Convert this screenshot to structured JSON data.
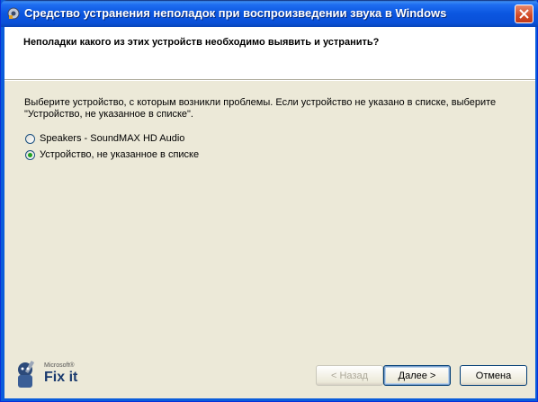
{
  "window": {
    "title": "Средство устранения неполадок при воспроизведении звука в Windows"
  },
  "header": {
    "question": "Неполадки какого из этих устройств необходимо выявить и устранить?"
  },
  "content": {
    "description_line1": "Выберите устройство, с которым возникли проблемы. Если устройство не указано в списке, выберите",
    "description_line2": "\"Устройство, не указанное в списке\".",
    "options": [
      {
        "label": "Speakers - SoundMAX HD Audio",
        "selected": false
      },
      {
        "label": "Устройство, не указанное в списке",
        "selected": true
      }
    ]
  },
  "branding": {
    "microsoft": "Microsoft®",
    "fixit": "Fix it"
  },
  "buttons": {
    "back": "< Назад",
    "next": "Далее >",
    "cancel": "Отмена"
  }
}
